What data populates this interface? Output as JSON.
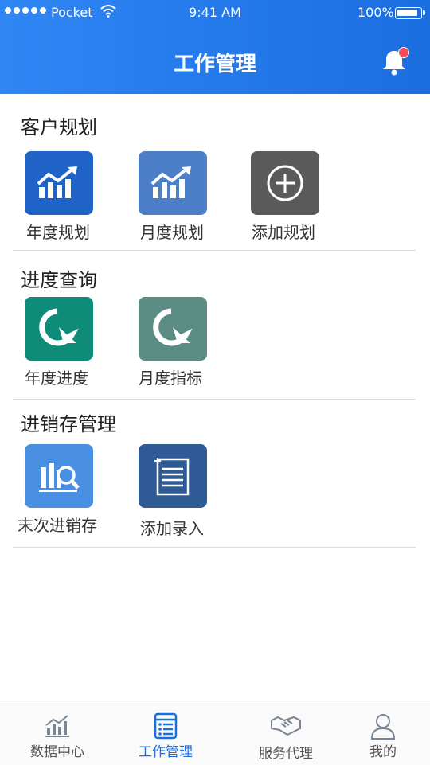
{
  "status_bar": {
    "carrier": "●●●●● Pocket",
    "carrier_name": "Pocket",
    "time": "9:41 AM",
    "battery": "100%"
  },
  "header": {
    "title": "工作管理"
  },
  "sections": [
    {
      "title": "客户规划",
      "items": [
        {
          "label": "年度规划",
          "color": "#1f63c6"
        },
        {
          "label": "月度规划",
          "color": "#4d7fc9"
        },
        {
          "label": "添加规划",
          "color": "#5a5a5a"
        }
      ]
    },
    {
      "title": "进度查询",
      "items": [
        {
          "label": "年度进度",
          "color": "#0f8b7a"
        },
        {
          "label": "月度指标",
          "color": "#5a8c83"
        }
      ]
    },
    {
      "title": "进销存管理",
      "items": [
        {
          "label": "末次进销存",
          "color": "#4a90e2"
        },
        {
          "label": "添加录入",
          "color": "#2e5a96"
        }
      ]
    }
  ],
  "tabbar": [
    {
      "label": "数据中心",
      "active": false
    },
    {
      "label": "工作管理",
      "active": true
    },
    {
      "label": "服务代理",
      "active": false
    },
    {
      "label": "我的",
      "active": false
    }
  ],
  "icons": [
    "signal-icon",
    "wifi-icon",
    "battery-icon",
    "bell-icon",
    "bar-chart-up-icon",
    "add-circle-icon",
    "pie-chart-icon",
    "inventory-search-icon",
    "document-list-icon",
    "chart-tab-icon",
    "list-tab-icon",
    "handshake-icon",
    "user-icon"
  ],
  "colors": {
    "primary": "#1b6ee0",
    "badge": "#f24b5b"
  }
}
